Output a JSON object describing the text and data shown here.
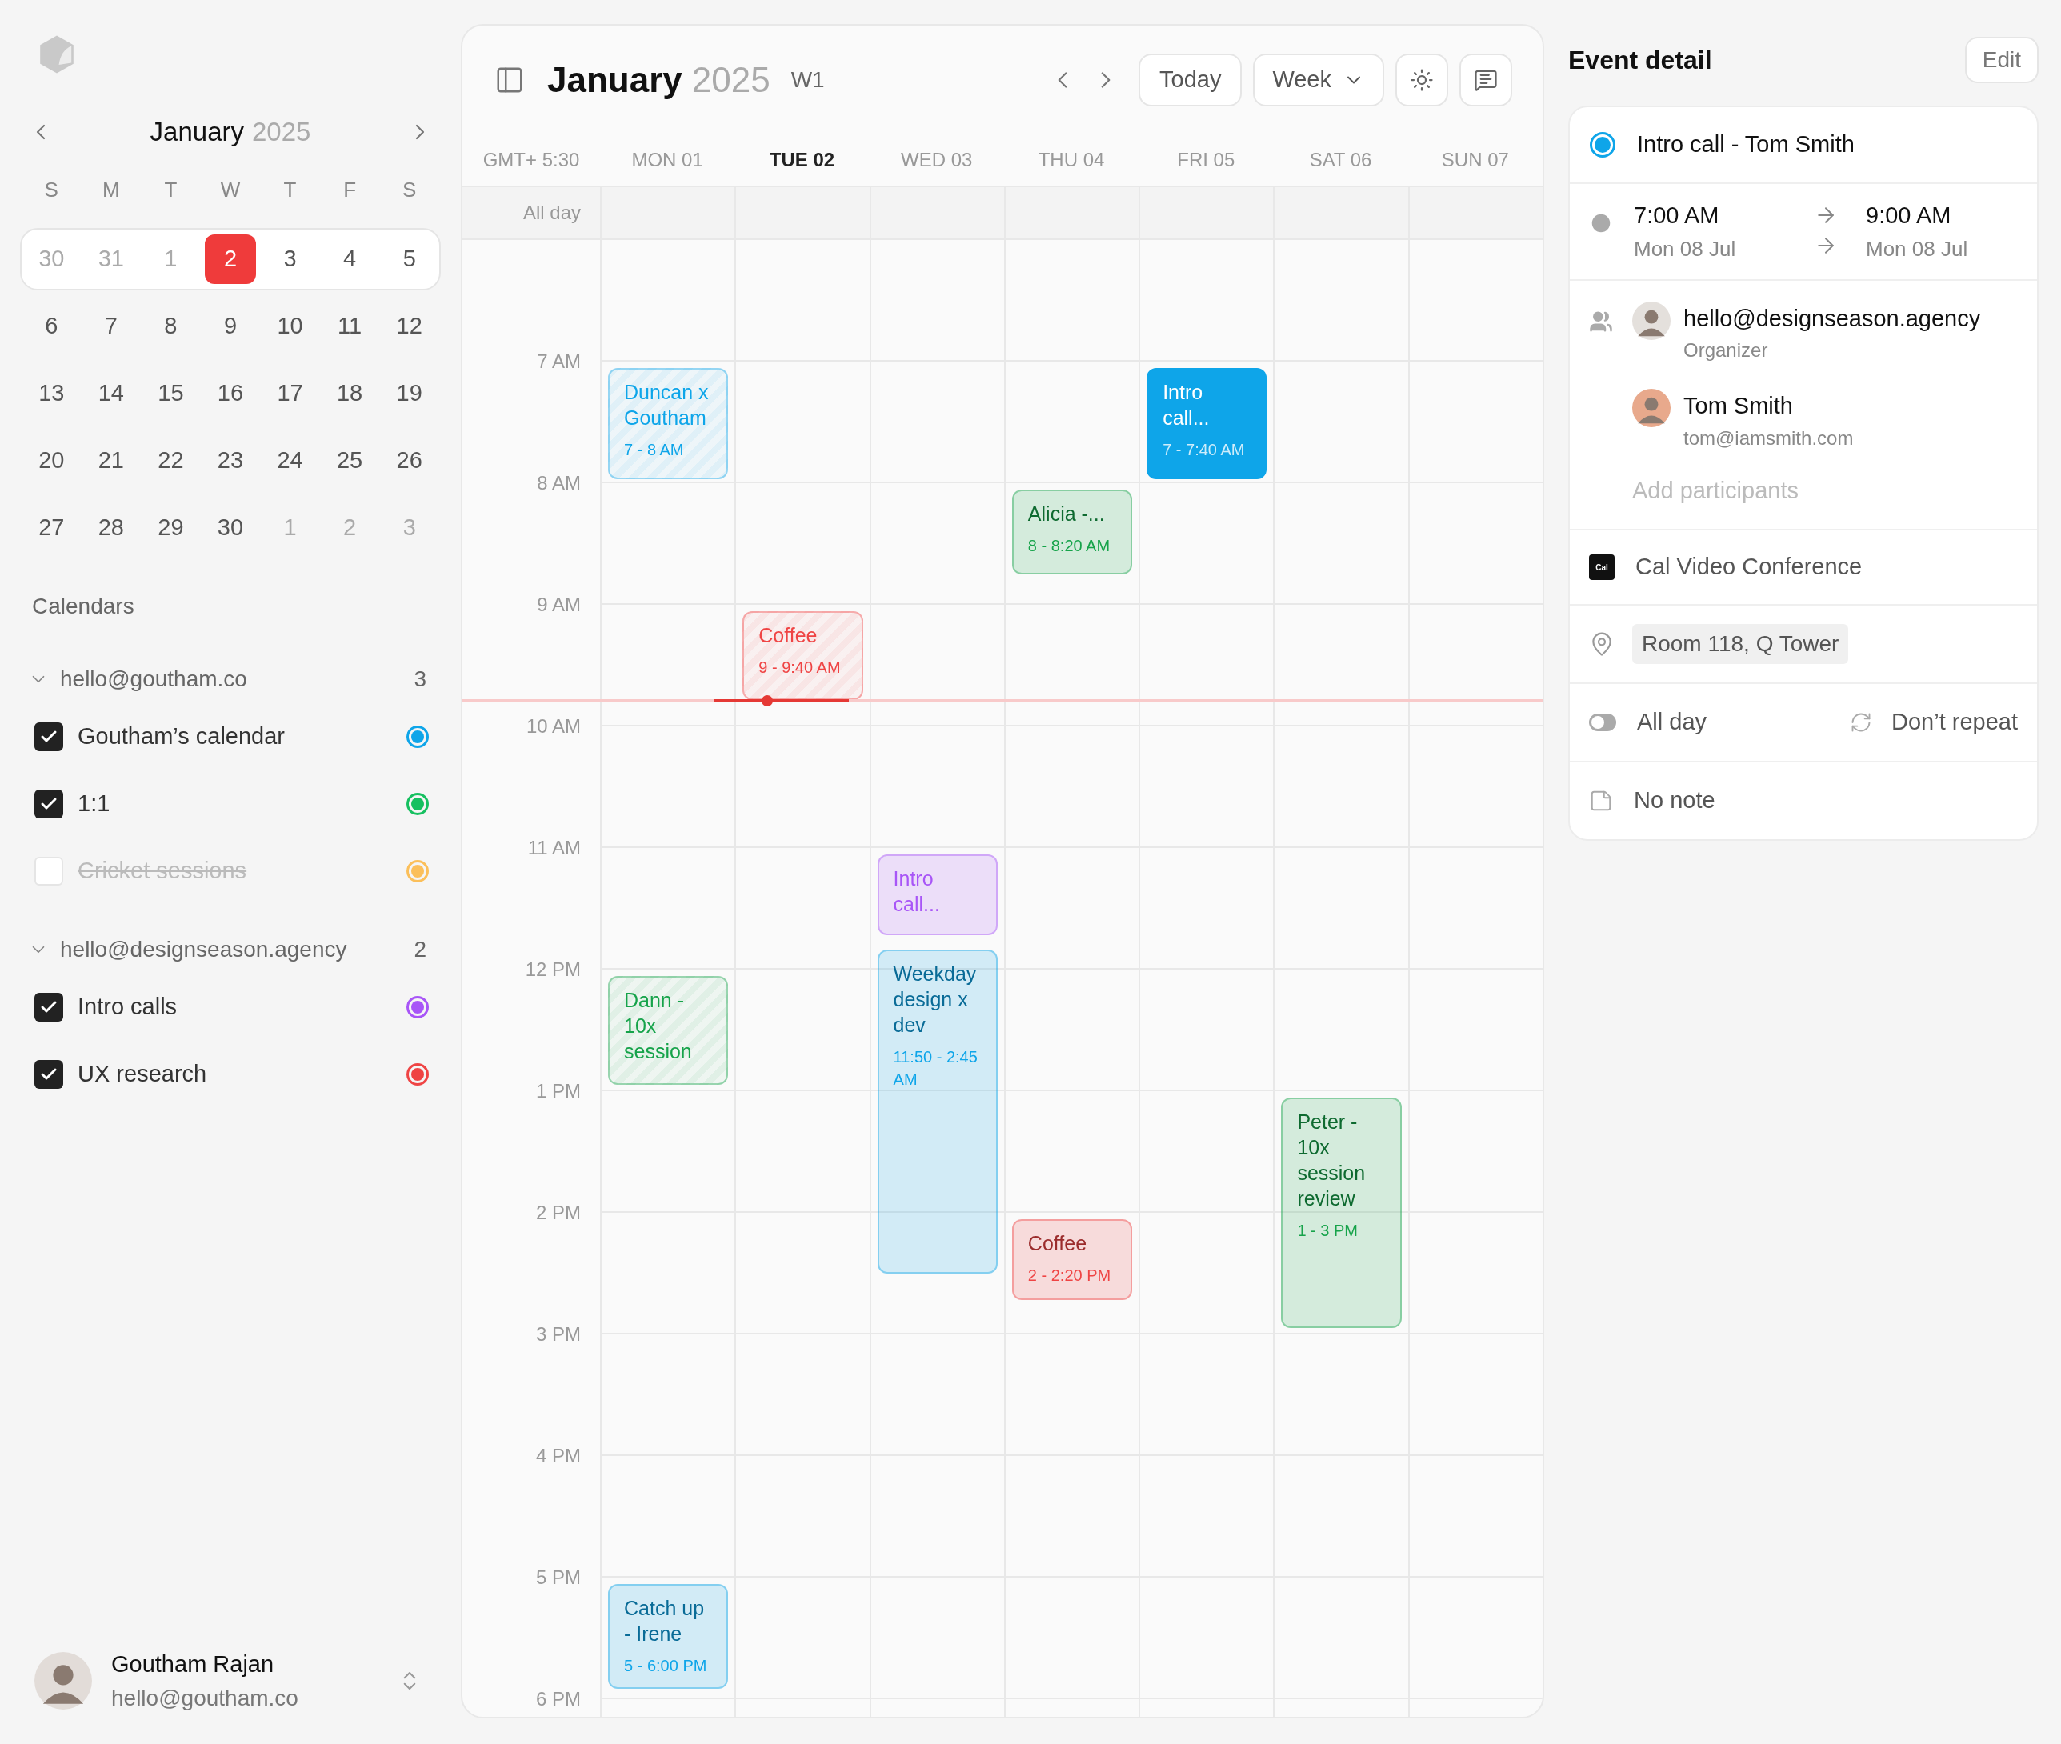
{
  "sidebar": {
    "month": "January",
    "year": "2025",
    "weekdays": [
      "S",
      "M",
      "T",
      "W",
      "T",
      "F",
      "S"
    ],
    "weeks": [
      {
        "selected": true,
        "days": [
          {
            "label": "30",
            "muted": true,
            "selected": false
          },
          {
            "label": "31",
            "muted": true,
            "selected": false
          },
          {
            "label": "1",
            "muted": true,
            "selected": false
          },
          {
            "label": "2",
            "muted": false,
            "selected": true
          },
          {
            "label": "3",
            "muted": false,
            "selected": false
          },
          {
            "label": "4",
            "muted": false,
            "selected": false
          },
          {
            "label": "5",
            "muted": false,
            "selected": false
          }
        ]
      },
      {
        "selected": false,
        "days": [
          {
            "label": "6",
            "muted": false,
            "selected": false
          },
          {
            "label": "7",
            "muted": false,
            "selected": false
          },
          {
            "label": "8",
            "muted": false,
            "selected": false
          },
          {
            "label": "9",
            "muted": false,
            "selected": false
          },
          {
            "label": "10",
            "muted": false,
            "selected": false
          },
          {
            "label": "11",
            "muted": false,
            "selected": false
          },
          {
            "label": "12",
            "muted": false,
            "selected": false
          }
        ]
      },
      {
        "selected": false,
        "days": [
          {
            "label": "13",
            "muted": false,
            "selected": false
          },
          {
            "label": "14",
            "muted": false,
            "selected": false
          },
          {
            "label": "15",
            "muted": false,
            "selected": false
          },
          {
            "label": "16",
            "muted": false,
            "selected": false
          },
          {
            "label": "17",
            "muted": false,
            "selected": false
          },
          {
            "label": "18",
            "muted": false,
            "selected": false
          },
          {
            "label": "19",
            "muted": false,
            "selected": false
          }
        ]
      },
      {
        "selected": false,
        "days": [
          {
            "label": "20",
            "muted": false,
            "selected": false
          },
          {
            "label": "21",
            "muted": false,
            "selected": false
          },
          {
            "label": "22",
            "muted": false,
            "selected": false
          },
          {
            "label": "23",
            "muted": false,
            "selected": false
          },
          {
            "label": "24",
            "muted": false,
            "selected": false
          },
          {
            "label": "25",
            "muted": false,
            "selected": false
          },
          {
            "label": "26",
            "muted": false,
            "selected": false
          }
        ]
      },
      {
        "selected": false,
        "days": [
          {
            "label": "27",
            "muted": false,
            "selected": false
          },
          {
            "label": "28",
            "muted": false,
            "selected": false
          },
          {
            "label": "29",
            "muted": false,
            "selected": false
          },
          {
            "label": "30",
            "muted": false,
            "selected": false
          },
          {
            "label": "1",
            "muted": true,
            "selected": false
          },
          {
            "label": "2",
            "muted": true,
            "selected": false
          },
          {
            "label": "3",
            "muted": true,
            "selected": false
          }
        ]
      }
    ],
    "calendars_title": "Calendars",
    "accounts": [
      {
        "email": "hello@goutham.co",
        "count": "3",
        "expanded": true,
        "calendars": [
          {
            "name": "Goutham’s calendar",
            "checked": true,
            "color": "#0ea5e9"
          },
          {
            "name": "1:1",
            "checked": true,
            "color": "#16c060"
          },
          {
            "name": "Cricket sessions",
            "checked": false,
            "color": "#fbbf5a"
          }
        ]
      },
      {
        "email": "hello@designseason.agency",
        "count": "2",
        "expanded": true,
        "calendars": [
          {
            "name": "Intro calls",
            "checked": true,
            "color": "#a855f7"
          },
          {
            "name": "UX research",
            "checked": true,
            "color": "#ef4444"
          }
        ]
      }
    ],
    "user": {
      "name": "Goutham Rajan",
      "email": "hello@goutham.co"
    }
  },
  "header": {
    "month": "January",
    "year": "2025",
    "week": "W1",
    "today": "Today",
    "view": "Week"
  },
  "grid": {
    "timezone": "GMT+ 5:30",
    "all_day": "All day",
    "hours": [
      "7 AM",
      "8 AM",
      "9 AM",
      "10 AM",
      "11 AM",
      "12 PM",
      "1 PM",
      "2 PM",
      "3 PM",
      "4 PM",
      "5 PM",
      "6 PM"
    ],
    "days": [
      {
        "label": "MON 01",
        "selected": false,
        "events": [
          {
            "title": "Duncan x Goutham",
            "time": "7 - 8 AM",
            "color": "#0ea5e9",
            "past": true,
            "selected": false
          },
          {
            "title": "Dann - 10x session",
            "color": "#16a34a",
            "past": true,
            "selected": false
          },
          {
            "title": "Catch up - Irene",
            "time": "5 - 6:00 PM",
            "color": "#0ea5e9",
            "past": false,
            "selected": false
          }
        ]
      },
      {
        "label": "TUE 02",
        "selected": true,
        "events": [
          {
            "title": "Coffee",
            "time": "9 - 9:40 AM",
            "color": "#ef4444",
            "past": true,
            "selected": false
          }
        ]
      },
      {
        "label": "WED 03",
        "selected": false,
        "events": [
          {
            "title": "Intro call...",
            "color": "#a855f7",
            "past": false,
            "selected": false
          },
          {
            "title": "Weekday design x dev",
            "time": "11:50 - 2:45 AM",
            "color": "#0ea5e9",
            "past": false,
            "selected": false
          }
        ]
      },
      {
        "label": "THU 04",
        "selected": false,
        "events": [
          {
            "title": "Alicia -...",
            "time": "8 - 8:20 AM",
            "color": "#16a34a",
            "past": false,
            "selected": false
          },
          {
            "title": "Coffee",
            "time": "2 - 2:20 PM",
            "color": "#ef4444",
            "past": false,
            "selected": false
          }
        ]
      },
      {
        "label": "FRI 05",
        "selected": false,
        "events": [
          {
            "title": "Intro call...",
            "time": "7 - 7:40 AM",
            "color": "#0ea5e9",
            "past": false,
            "selected": true
          }
        ]
      },
      {
        "label": "SAT 06",
        "selected": false,
        "events": [
          {
            "title": "Peter - 10x session review",
            "time": "1 - 3 PM",
            "color": "#16a34a",
            "past": false,
            "selected": false
          }
        ]
      },
      {
        "label": "SUN 07",
        "selected": false
      }
    ]
  },
  "detail": {
    "title": "Event detail",
    "edit": "Edit",
    "event": {
      "title": "Intro call - Tom Smith",
      "color": "#0ea5e9",
      "start_time": "7:00 AM",
      "start_date": "Mon 08 Jul",
      "end_time": "9:00 AM",
      "end_date": "Mon 08 Jul",
      "participants": [
        {
          "name": "hello@designseason.agency",
          "detail": "Organizer"
        },
        {
          "name": "Tom Smith",
          "detail": "tom@iamsmith.com"
        }
      ],
      "add_participants": {
        "placeholder": "Add participants"
      },
      "conference_logo": "Cal",
      "conference": "Cal Video Conference",
      "location": "Room 118, Q Tower",
      "all_day": {
        "label": "All day",
        "on": false
      },
      "repeat": "Don’t repeat",
      "note": "No note"
    }
  }
}
